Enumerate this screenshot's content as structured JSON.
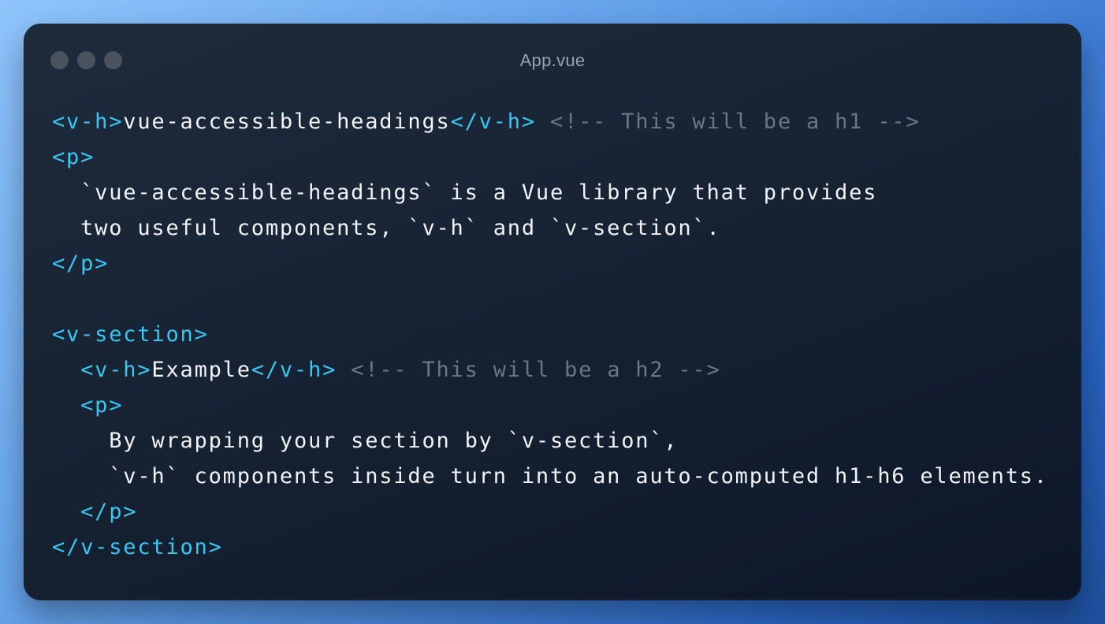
{
  "window": {
    "title": "App.vue"
  },
  "colors": {
    "tag": "#38c6f2",
    "text": "#f1f3f6",
    "comment": "#6b7683",
    "window_background": "#162232",
    "traffic_light": "#4a525d"
  },
  "code": {
    "lines": [
      [
        {
          "t": "tag",
          "v": "<v-h>"
        },
        {
          "t": "txt",
          "v": "vue-accessible-headings"
        },
        {
          "t": "tag",
          "v": "</v-h>"
        },
        {
          "t": "txt",
          "v": " "
        },
        {
          "t": "cmt",
          "v": "<!-- This will be a h1 -->"
        }
      ],
      [
        {
          "t": "tag",
          "v": "<p>"
        }
      ],
      [
        {
          "t": "txt",
          "v": "  `vue-accessible-headings` is a Vue library that provides"
        }
      ],
      [
        {
          "t": "txt",
          "v": "  two useful components, `v-h` and `v-section`."
        }
      ],
      [
        {
          "t": "tag",
          "v": "</p>"
        }
      ],
      [],
      [
        {
          "t": "tag",
          "v": "<v-section>"
        }
      ],
      [
        {
          "t": "txt",
          "v": "  "
        },
        {
          "t": "tag",
          "v": "<v-h>"
        },
        {
          "t": "txt",
          "v": "Example"
        },
        {
          "t": "tag",
          "v": "</v-h>"
        },
        {
          "t": "txt",
          "v": " "
        },
        {
          "t": "cmt",
          "v": "<!-- This will be a h2 -->"
        }
      ],
      [
        {
          "t": "txt",
          "v": "  "
        },
        {
          "t": "tag",
          "v": "<p>"
        }
      ],
      [
        {
          "t": "txt",
          "v": "    By wrapping your section by `v-section`,"
        }
      ],
      [
        {
          "t": "txt",
          "v": "    `v-h` components inside turn into an auto-computed h1-h6 elements."
        }
      ],
      [
        {
          "t": "txt",
          "v": "  "
        },
        {
          "t": "tag",
          "v": "</p>"
        }
      ],
      [
        {
          "t": "tag",
          "v": "</v-section>"
        }
      ]
    ]
  }
}
